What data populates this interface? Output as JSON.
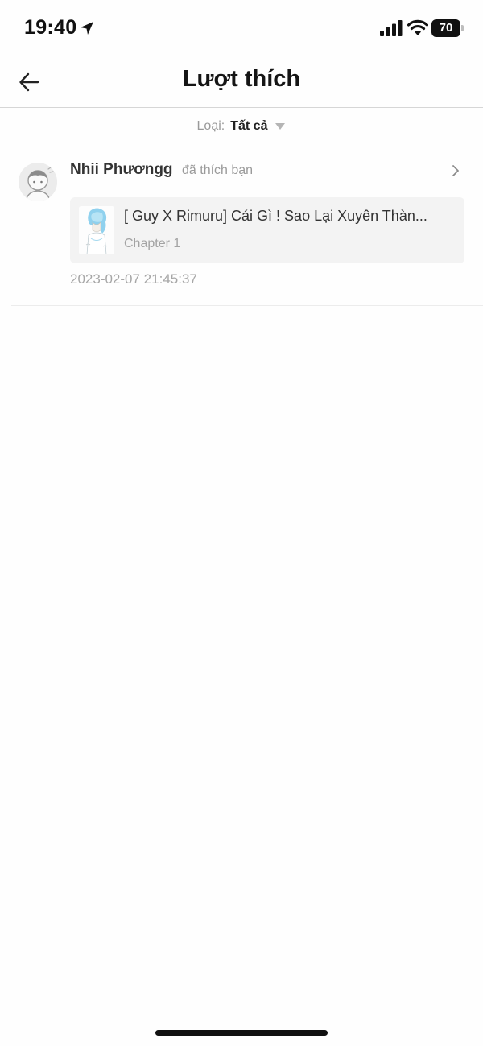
{
  "status_bar": {
    "time": "19:40",
    "battery": "70",
    "icons": [
      "location-arrow-icon",
      "cellular-signal-icon",
      "wifi-icon",
      "battery-icon"
    ]
  },
  "header": {
    "title": "Lượt thích",
    "back_icon": "arrow-left-icon"
  },
  "filter": {
    "label": "Loại:",
    "value": "Tất cả",
    "icon": "caret-down-icon"
  },
  "notifications": [
    {
      "user_name": "Nhii Phươngg",
      "action": "đã thích bạn",
      "story_title": "[ Guy X Rimuru] Cái Gì ! Sao Lại Xuyên Thàn...",
      "chapter": "Chapter 1",
      "timestamp": "2023-02-07 21:45:37"
    }
  ],
  "colors": {
    "background": "#fefefe",
    "card_background": "#f3f3f3",
    "muted_text": "#9a9a9a",
    "divider": "#d6d6d6"
  }
}
